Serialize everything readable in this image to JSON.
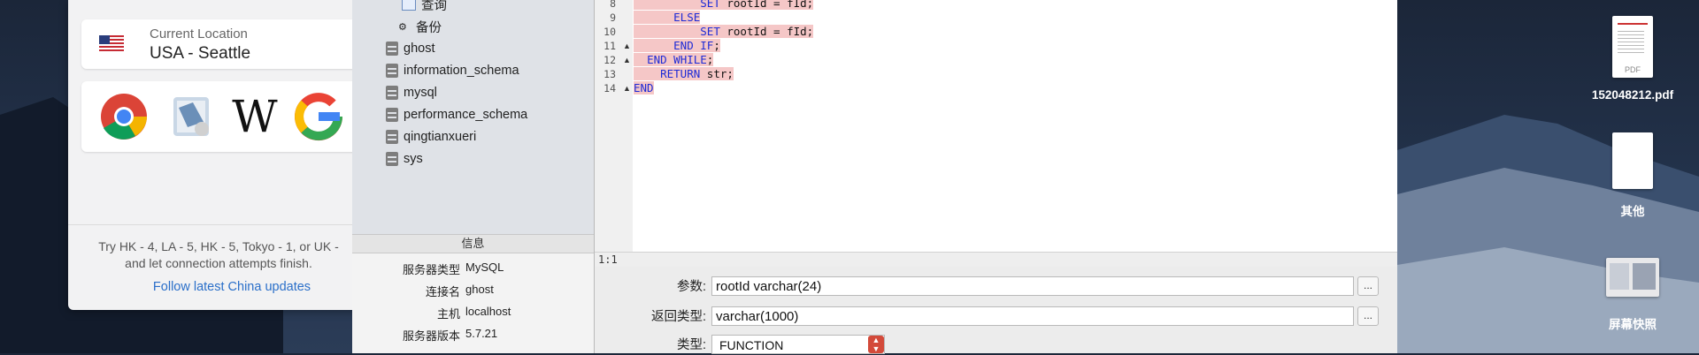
{
  "vpn": {
    "current_location_label": "Current Location",
    "current_location_value": "USA - Seattle",
    "flag_icon": "us-flag-icon",
    "apps": [
      {
        "name": "chrome-icon"
      },
      {
        "name": "mail-icon"
      },
      {
        "name": "wikipedia-icon",
        "glyph": "W"
      },
      {
        "name": "google-icon",
        "glyph": "G"
      }
    ],
    "hint_line1": "Try HK - 4, LA - 5, HK - 5, Tokyo - 1, or UK - ",
    "hint_line2": "and let connection attempts finish.",
    "link": "Follow latest China updates"
  },
  "tree": {
    "partial_items": [
      {
        "label": "查询",
        "icon": "query-icon"
      },
      {
        "label": "备份",
        "icon": "backup-icon"
      }
    ],
    "databases": [
      "ghost",
      "information_schema",
      "mysql",
      "performance_schema",
      "qingtianxueri",
      "sys"
    ]
  },
  "info": {
    "header": "信息",
    "rows": [
      {
        "key": "服务器类型",
        "value": "MySQL"
      },
      {
        "key": "连接名",
        "value": "ghost"
      },
      {
        "key": "主机",
        "value": "localhost"
      },
      {
        "key": "服务器版本",
        "value": "5.7.21"
      }
    ]
  },
  "editor": {
    "lines": [
      {
        "num": "8",
        "fold": ""
      },
      {
        "num": "9",
        "fold": ""
      },
      {
        "num": "10",
        "fold": ""
      },
      {
        "num": "11",
        "fold": "▲"
      },
      {
        "num": "12",
        "fold": "▲"
      },
      {
        "num": "13",
        "fold": ""
      },
      {
        "num": "14",
        "fold": "▲"
      }
    ],
    "cursor_pos": "1:1"
  },
  "form": {
    "params_label": "参数:",
    "params_value": "rootId varchar(24)",
    "return_label": "返回类型:",
    "return_value": "varchar(1000)",
    "type_label": "类型:",
    "type_value": "FUNCTION",
    "more_button": "..."
  },
  "desktop": {
    "items": [
      {
        "label": "152048212.pdf",
        "icon": "pdf-file-icon",
        "badge": "PDF"
      },
      {
        "label": "其他",
        "icon": "document-file-icon"
      },
      {
        "label": "屏幕快照",
        "icon": "screenshot-file-icon"
      }
    ]
  }
}
